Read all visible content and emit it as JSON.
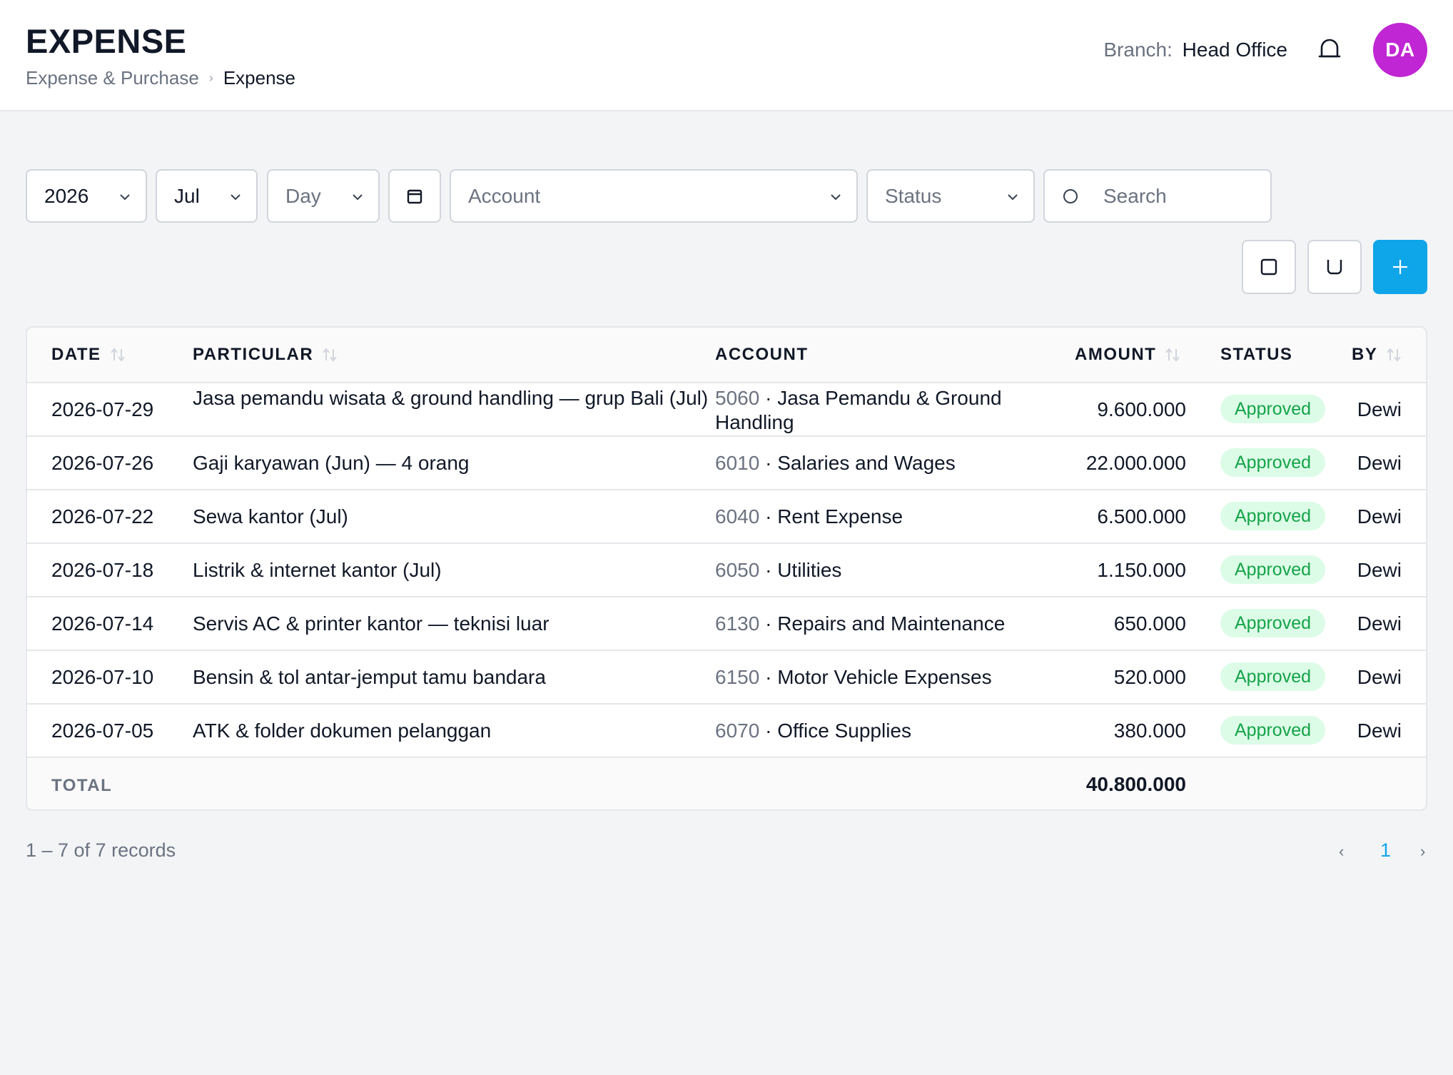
{
  "header": {
    "title": "EXPENSE",
    "breadcrumb": {
      "parent": "Expense & Purchase",
      "separator": "›",
      "current": "Expense"
    },
    "branch_label": "Branch:",
    "branch_value": "Head Office",
    "avatar_initials": "DA",
    "avatar_color": "#c026d3"
  },
  "filters": {
    "year": "2026",
    "month": "Jul",
    "day_placeholder": "Day",
    "account_placeholder": "Account",
    "status_placeholder": "Status",
    "search_placeholder": "Search"
  },
  "icons": {
    "bell": "bell-icon",
    "calendar": "calendar-icon",
    "search": "search-icon",
    "chevron": "chevron-down-icon",
    "sort": "sort-icon",
    "action_1": "square-icon",
    "action_2": "upload-icon",
    "add": "plus-icon"
  },
  "accent_color": "#0ea5e9",
  "table": {
    "columns": {
      "date": "DATE",
      "particular": "PARTICULAR",
      "account": "ACCOUNT",
      "amount": "AMOUNT",
      "status": "STATUS",
      "by": "BY"
    },
    "rows": [
      {
        "date": "2026-07-29",
        "particular": "Jasa pemandu wisata & ground handling — grup Bali (Jul)",
        "account_code": "5060",
        "account_name": "Jasa Pemandu & Ground Handling",
        "amount": "9.600.000",
        "status": "Approved",
        "by": "Dewi"
      },
      {
        "date": "2026-07-26",
        "particular": "Gaji karyawan (Jun) — 4 orang",
        "account_code": "6010",
        "account_name": "Salaries and Wages",
        "amount": "22.000.000",
        "status": "Approved",
        "by": "Dewi"
      },
      {
        "date": "2026-07-22",
        "particular": "Sewa kantor (Jul)",
        "account_code": "6040",
        "account_name": "Rent Expense",
        "amount": "6.500.000",
        "status": "Approved",
        "by": "Dewi"
      },
      {
        "date": "2026-07-18",
        "particular": "Listrik & internet kantor (Jul)",
        "account_code": "6050",
        "account_name": "Utilities",
        "amount": "1.150.000",
        "status": "Approved",
        "by": "Dewi"
      },
      {
        "date": "2026-07-14",
        "particular": "Servis AC & printer kantor — teknisi luar",
        "account_code": "6130",
        "account_name": "Repairs and Maintenance",
        "amount": "650.000",
        "status": "Approved",
        "by": "Dewi"
      },
      {
        "date": "2026-07-10",
        "particular": "Bensin & tol antar-jemput tamu bandara",
        "account_code": "6150",
        "account_name": "Motor Vehicle Expenses",
        "amount": "520.000",
        "status": "Approved",
        "by": "Dewi"
      },
      {
        "date": "2026-07-05",
        "particular": "ATK & folder dokumen pelanggan",
        "account_code": "6070",
        "account_name": "Office Supplies",
        "amount": "380.000",
        "status": "Approved",
        "by": "Dewi"
      }
    ],
    "total_label": "TOTAL",
    "total_value": "40.800.000",
    "status_color": "#16a34a",
    "status_bg": "#dcfce7"
  },
  "footer": {
    "records": "1 – 7 of 7 records",
    "prev": "‹",
    "page": "1",
    "next": "›"
  }
}
